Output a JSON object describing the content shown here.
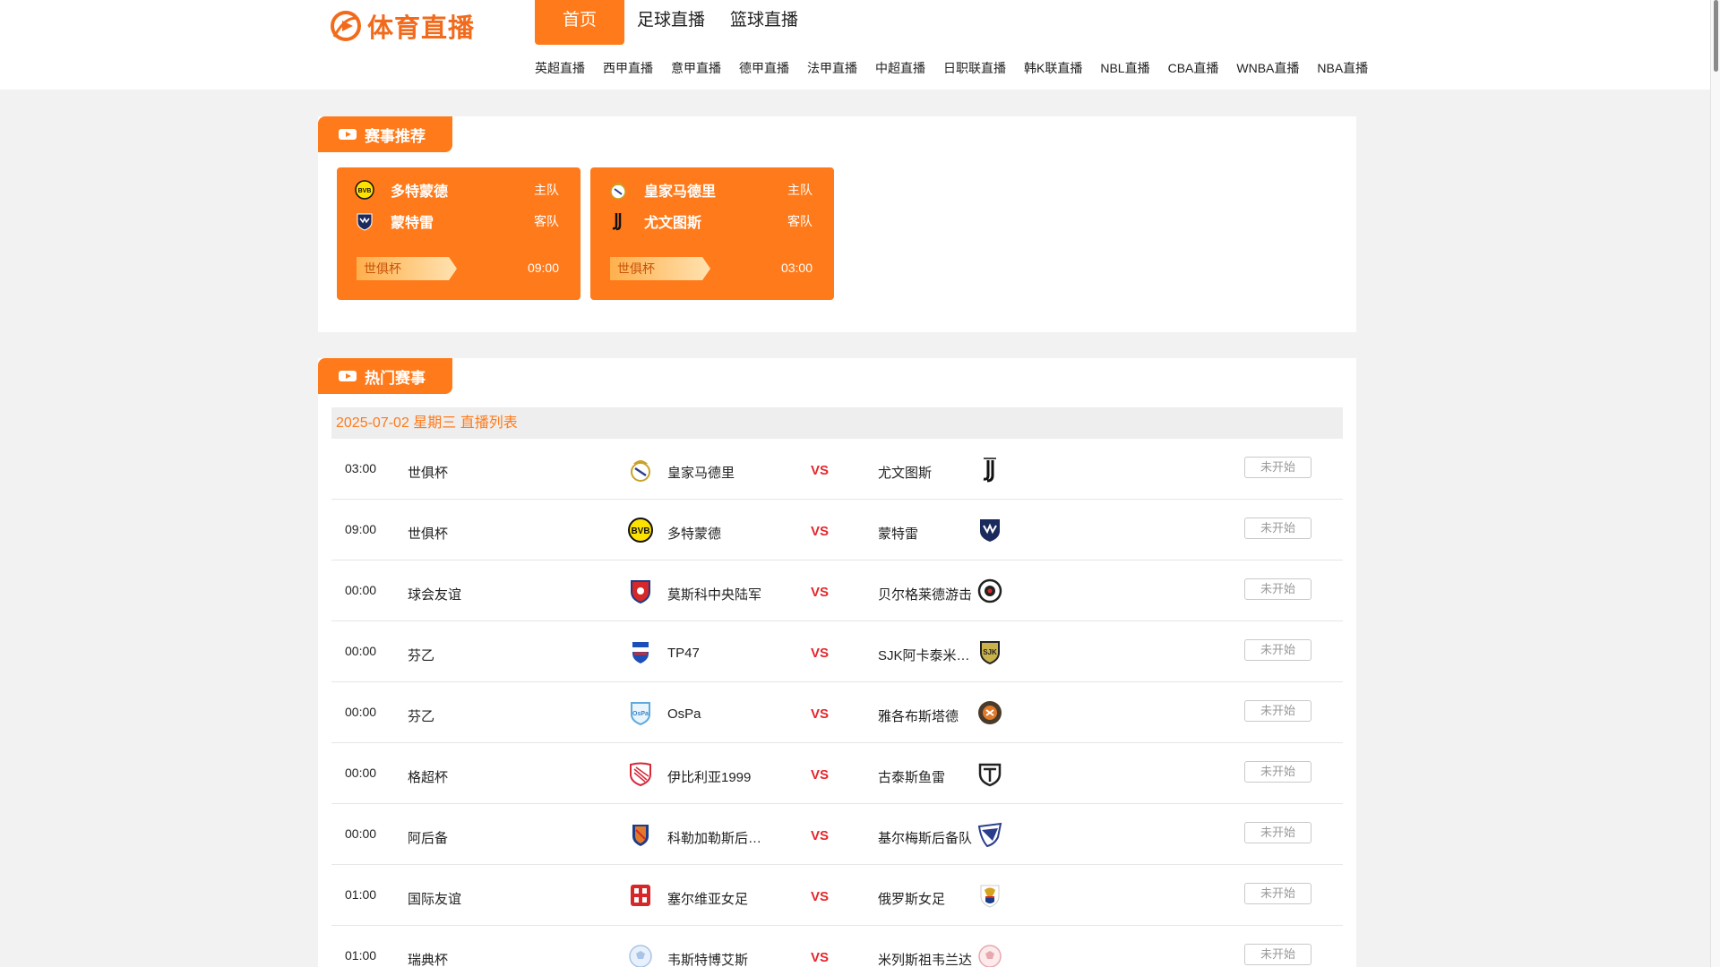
{
  "brand": {
    "name": "体育直播",
    "accent": "#ff7a1a"
  },
  "nav": {
    "main": [
      "首页",
      "足球直播",
      "篮球直播"
    ],
    "sub": [
      "英超直播",
      "西甲直播",
      "意甲直播",
      "德甲直播",
      "法甲直播",
      "中超直播",
      "日职联直播",
      "韩K联直播",
      "NBL直播",
      "CBA直播",
      "WNBA直播",
      "NBA直播"
    ]
  },
  "recommend": {
    "title": "赛事推荐",
    "cards": [
      {
        "home": "多特蒙德",
        "home_role": "主队",
        "away": "蒙特雷",
        "away_role": "客队",
        "league": "世俱杯",
        "time": "09:00",
        "home_icon": "dortmund-badge",
        "away_icon": "monterrey-badge"
      },
      {
        "home": "皇家马德里",
        "home_role": "主队",
        "away": "尤文图斯",
        "away_role": "客队",
        "league": "世俱杯",
        "time": "03:00",
        "home_icon": "real-madrid-badge",
        "away_icon": "juventus-badge"
      }
    ]
  },
  "hot": {
    "title": "热门赛事",
    "date_label": "2025-07-02 星期三 直播列表",
    "vs_label": "VS",
    "matches": [
      {
        "time": "03:00",
        "league": "世俱杯",
        "home": "皇家马德里",
        "away": "尤文图斯",
        "status": "未开始",
        "home_icon": "real-madrid-badge",
        "away_icon": "juventus-badge"
      },
      {
        "time": "09:00",
        "league": "世俱杯",
        "home": "多特蒙德",
        "away": "蒙特雷",
        "status": "未开始",
        "home_icon": "dortmund-badge",
        "away_icon": "monterrey-badge"
      },
      {
        "time": "00:00",
        "league": "球会友谊",
        "home": "莫斯科中央陆军",
        "away": "贝尔格莱德游击",
        "status": "未开始",
        "home_icon": "cska-moscow-badge",
        "away_icon": "partizan-badge"
      },
      {
        "time": "00:00",
        "league": "芬乙",
        "home": "TP47",
        "away": "SJK阿卡泰米…",
        "status": "未开始",
        "home_icon": "tp47-badge",
        "away_icon": "sjk-badge"
      },
      {
        "time": "00:00",
        "league": "芬乙",
        "home": "OsPa",
        "away": "雅各布斯塔德",
        "status": "未开始",
        "home_icon": "ospa-badge",
        "away_icon": "jakobstad-badge"
      },
      {
        "time": "00:00",
        "league": "格超杯",
        "home": "伊比利亚1999",
        "away": "古泰斯鱼雷",
        "status": "未开始",
        "home_icon": "iberia-badge",
        "away_icon": "torpedo-badge"
      },
      {
        "time": "00:00",
        "league": "阿后备",
        "home": "科勒加勒斯后…",
        "away": "基尔梅斯后备队",
        "status": "未开始",
        "home_icon": "colegiales-badge",
        "away_icon": "quilmes-badge"
      },
      {
        "time": "01:00",
        "league": "国际友谊",
        "home": "塞尔维亚女足",
        "away": "俄罗斯女足",
        "status": "未开始",
        "home_icon": "serbia-badge",
        "away_icon": "russia-badge"
      },
      {
        "time": "01:00",
        "league": "瑞典杯",
        "home": "韦斯特博艾斯",
        "away": "米列斯祖韦兰达",
        "status": "未开始",
        "home_icon": "generic-ball-badge",
        "away_icon": "generic-ball-badge"
      }
    ]
  }
}
